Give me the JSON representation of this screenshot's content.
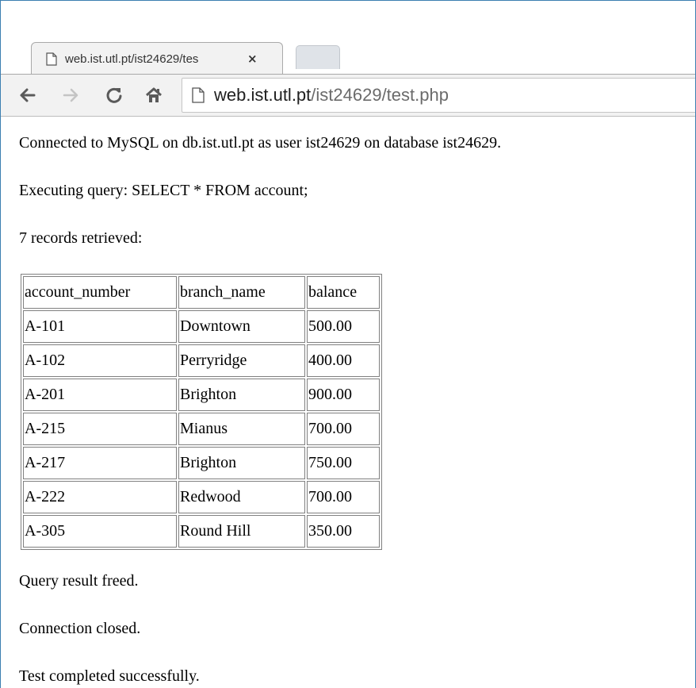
{
  "browser": {
    "tab_title": "web.ist.utl.pt/ist24629/tes",
    "tab_close": "×",
    "url_host": "web.ist.utl.pt",
    "url_path": "/ist24629/test.php",
    "icons": {
      "back": "back-arrow-icon",
      "forward": "forward-arrow-icon",
      "reload": "reload-icon",
      "home": "home-icon",
      "page": "page-icon"
    }
  },
  "page": {
    "connected_text": "Connected to MySQL on db.ist.utl.pt as user ist24629 on database ist24629.",
    "query_text": "Executing query: SELECT * FROM account;",
    "records_text": "7 records retrieved:",
    "freed_text": "Query result freed.",
    "closed_text": "Connection closed.",
    "completed_text": "Test completed successfully."
  },
  "table": {
    "headers": [
      "account_number",
      "branch_name",
      "balance"
    ],
    "rows": [
      [
        "A-101",
        "Downtown",
        "500.00"
      ],
      [
        "A-102",
        "Perryridge",
        "400.00"
      ],
      [
        "A-201",
        "Brighton",
        "900.00"
      ],
      [
        "A-215",
        "Mianus",
        "700.00"
      ],
      [
        "A-217",
        "Brighton",
        "750.00"
      ],
      [
        "A-222",
        "Redwood",
        "700.00"
      ],
      [
        "A-305",
        "Round Hill",
        "350.00"
      ]
    ]
  },
  "colors": {
    "window_border": "#3c7fb1",
    "toolbar_bg": "#f2f2f2",
    "url_path": "#6b6b6b"
  }
}
